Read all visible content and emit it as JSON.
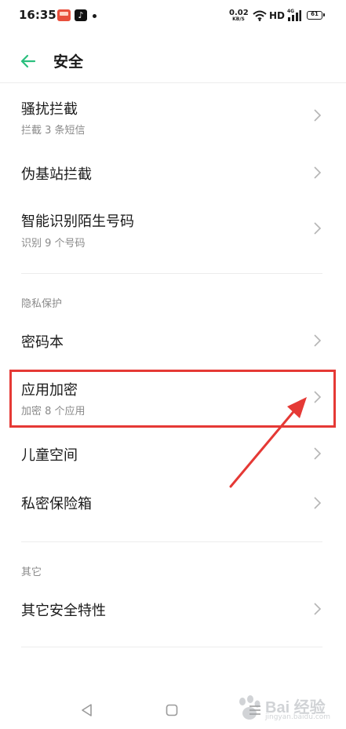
{
  "status_bar": {
    "time": "16:35",
    "net_speed_value": "0.02",
    "net_speed_unit": "KB/S",
    "hd": "HD",
    "network_tag": "4G",
    "battery": "61"
  },
  "header": {
    "title": "安全",
    "back_icon": "arrow-left-icon"
  },
  "items": [
    {
      "title": "骚扰拦截",
      "subtitle": "拦截 3 条短信"
    },
    {
      "title": "伪基站拦截"
    },
    {
      "title": "智能识别陌生号码",
      "subtitle": "识别 9 个号码"
    }
  ],
  "privacy_section": {
    "label": "隐私保护",
    "items": [
      {
        "title": "密码本"
      },
      {
        "title": "应用加密",
        "subtitle": "加密 8 个应用"
      },
      {
        "title": "儿童空间"
      },
      {
        "title": "私密保险箱"
      }
    ]
  },
  "other_section": {
    "label": "其它",
    "items": [
      {
        "title": "其它安全特性"
      }
    ]
  },
  "watermark": {
    "brand": "Bai 经验",
    "url": "jingyan.baidu.com"
  },
  "colors": {
    "accent": "#2bbf7e",
    "highlight": "#e53935",
    "chevron": "#b5b5b5",
    "subtitle": "#8a8a8a"
  }
}
